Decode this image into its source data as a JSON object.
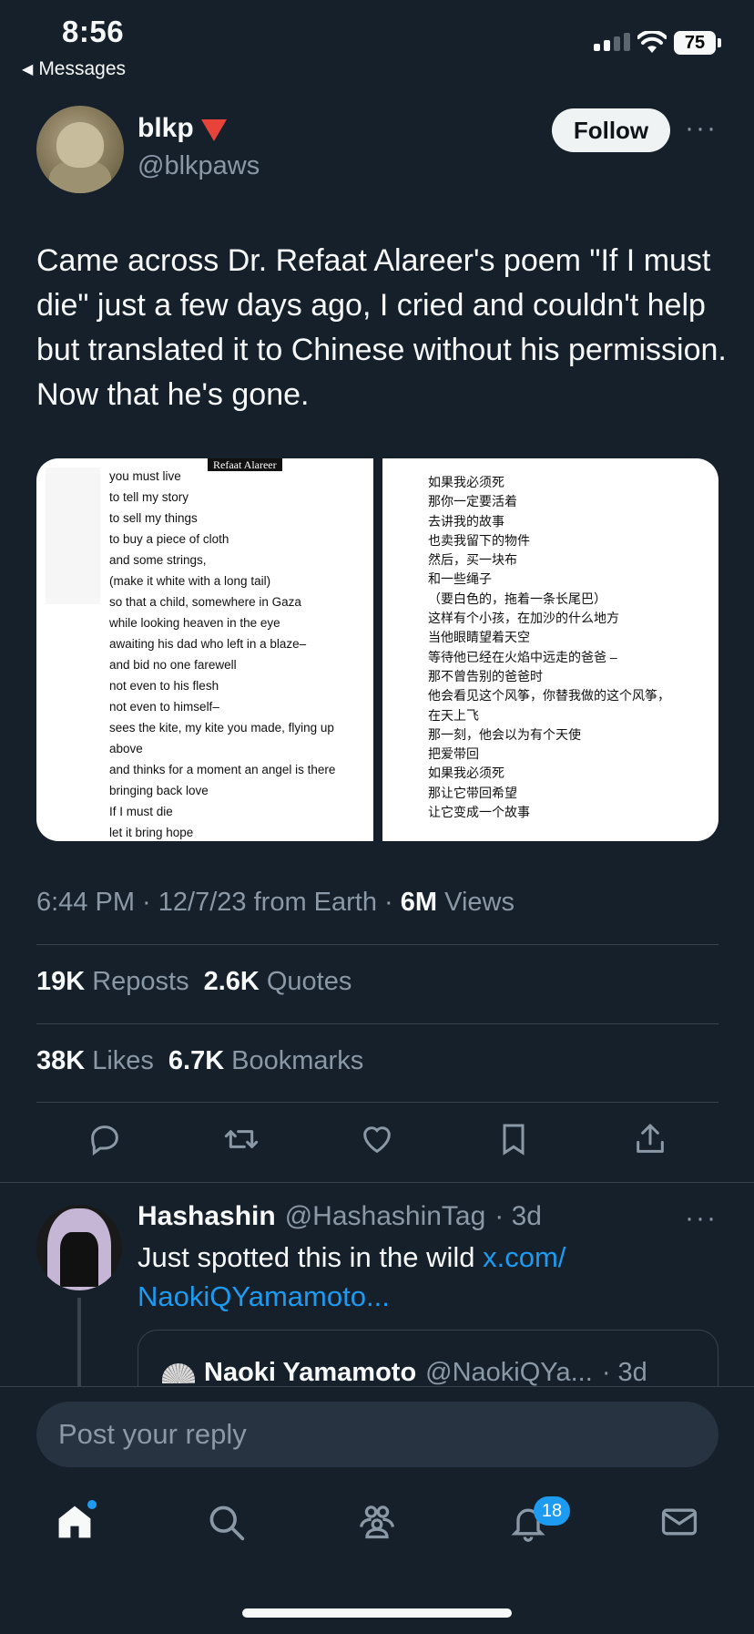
{
  "status_bar": {
    "time": "8:56",
    "back_label": "Messages",
    "battery": "75"
  },
  "post": {
    "author_name": "blkp",
    "author_handle": "@blkpaws",
    "follow_label": "Follow",
    "text": "Came across Dr. Refaat Alareer's poem \"If I must die\" just a few days ago, I cried and couldn't help but translated it to Chinese without his permission. Now that he's gone.",
    "image": {
      "left_tag": "Refaat Alareer",
      "left_lines": [
        "you must live",
        "to tell my story",
        "to sell my things",
        "to buy a piece of cloth",
        "and some strings,",
        "(make it white with a long tail)",
        "so that a child, somewhere in Gaza",
        "while looking heaven in the eye",
        "awaiting his dad who left in a blaze–",
        "and bid no one farewell",
        "not even to his flesh",
        "not even to himself–",
        "sees the kite, my kite you made, flying up",
        "above",
        "and thinks for a moment an angel is there",
        "bringing back love",
        "If I must die",
        "let it bring hope"
      ],
      "right_lines": [
        "如果我必须死",
        "那你一定要活着",
        "去讲我的故事",
        "也卖我留下的物件",
        "然后，买一块布",
        "和一些绳子",
        "（要白色的，拖着一条长尾巴）",
        "这样有个小孩，在加沙的什么地方",
        "当他眼睛望着天空",
        "等待他已经在火焰中远走的爸爸 –",
        "那不曾告别的爸爸时",
        "他会看见这个风筝，你替我做的这个风筝，",
        "在天上飞",
        "那一刻，他会以为有个天使",
        "把爱带回",
        "如果我必须死",
        "那让它带回希望",
        "让它变成一个故事"
      ]
    },
    "time": "6:44 PM",
    "date": "12/7/23",
    "source": "from Earth",
    "views_count": "6M",
    "views_label": "Views",
    "reposts_count": "19K",
    "reposts_label": "Reposts",
    "quotes_count": "2.6K",
    "quotes_label": "Quotes",
    "likes_count": "38K",
    "likes_label": "Likes",
    "bookmarks_count": "6.7K",
    "bookmarks_label": "Bookmarks"
  },
  "reply": {
    "name": "Hashashin",
    "handle": "@HashashinTag",
    "age": "· 3d",
    "text": "Just spotted this in the wild",
    "link": "x.com/ NaokiQYamamoto...",
    "quote_name": "Naoki Yamamoto",
    "quote_handle": "@NaokiQYa...",
    "quote_age": "· 3d"
  },
  "compose": {
    "placeholder": "Post your reply"
  },
  "tabbar": {
    "notifications_badge": "18"
  },
  "colors": {
    "background": "#15202b",
    "accent": "#1d9bf0",
    "muted": "#8b98a5"
  }
}
